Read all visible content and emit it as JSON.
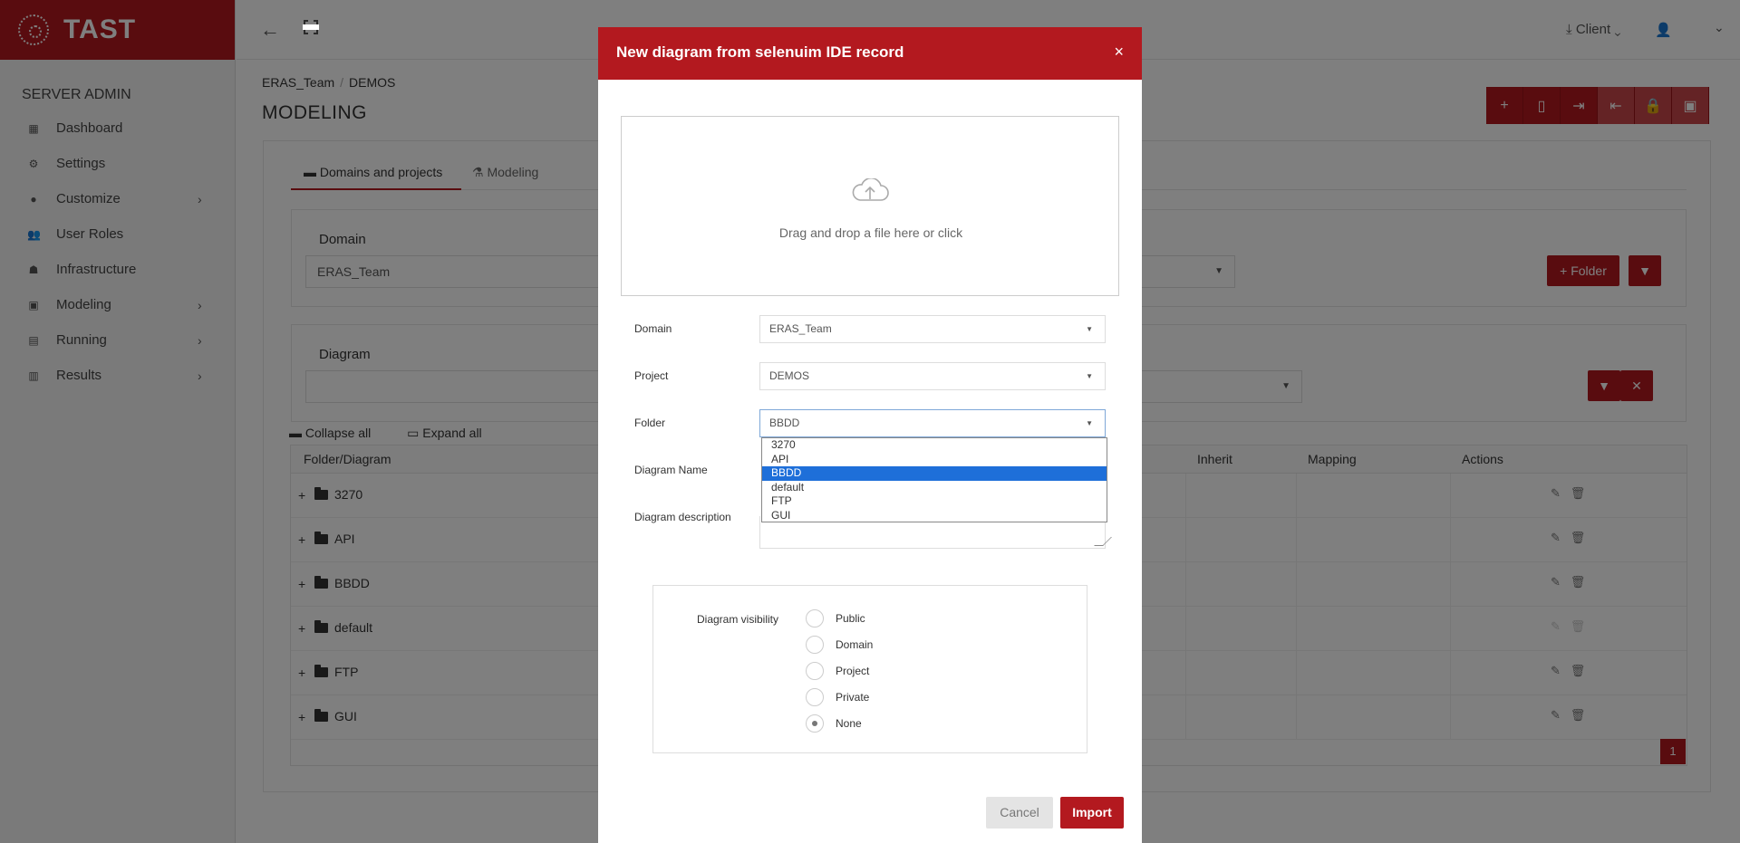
{
  "brand": {
    "name": "TAST"
  },
  "sidebar": {
    "section": "SERVER ADMIN",
    "items": [
      {
        "label": "Dashboard",
        "icon": "dashboard-icon",
        "has_submenu": false
      },
      {
        "label": "Settings",
        "icon": "gear-icon",
        "has_submenu": false
      },
      {
        "label": "Customize",
        "icon": "circle-icon",
        "has_submenu": true
      },
      {
        "label": "User Roles",
        "icon": "users-icon",
        "has_submenu": false
      },
      {
        "label": "Infrastructure",
        "icon": "infrastructure-icon",
        "has_submenu": false
      },
      {
        "label": "Modeling",
        "icon": "briefcase-icon",
        "has_submenu": true
      },
      {
        "label": "Running",
        "icon": "calendar-icon",
        "has_submenu": true
      },
      {
        "label": "Results",
        "icon": "bar-chart-icon",
        "has_submenu": true
      }
    ]
  },
  "topbar": {
    "client_label": "Client"
  },
  "breadcrumb": {
    "domain": "ERAS_Team",
    "project": "DEMOS"
  },
  "page": {
    "title": "MODELING"
  },
  "tabs": {
    "domains_projects": "Domains and projects",
    "modeling": "Modeling"
  },
  "domain_panel": {
    "label": "Domain",
    "value": "ERAS_Team",
    "folder_button": "+ Folder"
  },
  "diagram_panel": {
    "label": "Diagram",
    "value": ""
  },
  "tree": {
    "collapse_all": "Collapse all",
    "expand_all": "Expand all",
    "columns": [
      "Folder/Diagram",
      "Inherit",
      "Mapping",
      "Actions"
    ],
    "rows": [
      "3270",
      "API",
      "BBDD",
      "default",
      "FTP",
      "GUI"
    ],
    "page": "1"
  },
  "modal": {
    "title": "New diagram from selenuim IDE record",
    "close": "×",
    "dropzone_text": "Drag and drop a file here or click",
    "domain_label": "Domain",
    "domain_value": "ERAS_Team",
    "project_label": "Project",
    "project_value": "DEMOS",
    "folder_label": "Folder",
    "folder_value": "BBDD",
    "folder_options": [
      "3270",
      "API",
      "BBDD",
      "default",
      "FTP",
      "GUI"
    ],
    "folder_selected_index": 2,
    "name_label": "Diagram Name",
    "description_label": "Diagram description",
    "visibility_label": "Diagram visibility",
    "visibility_options": [
      "Public",
      "Domain",
      "Project",
      "Private",
      "None"
    ],
    "visibility_selected": "None",
    "cancel": "Cancel",
    "import": "Import"
  },
  "colors": {
    "brand": "#b3191f",
    "selection": "#1e6fd9"
  }
}
